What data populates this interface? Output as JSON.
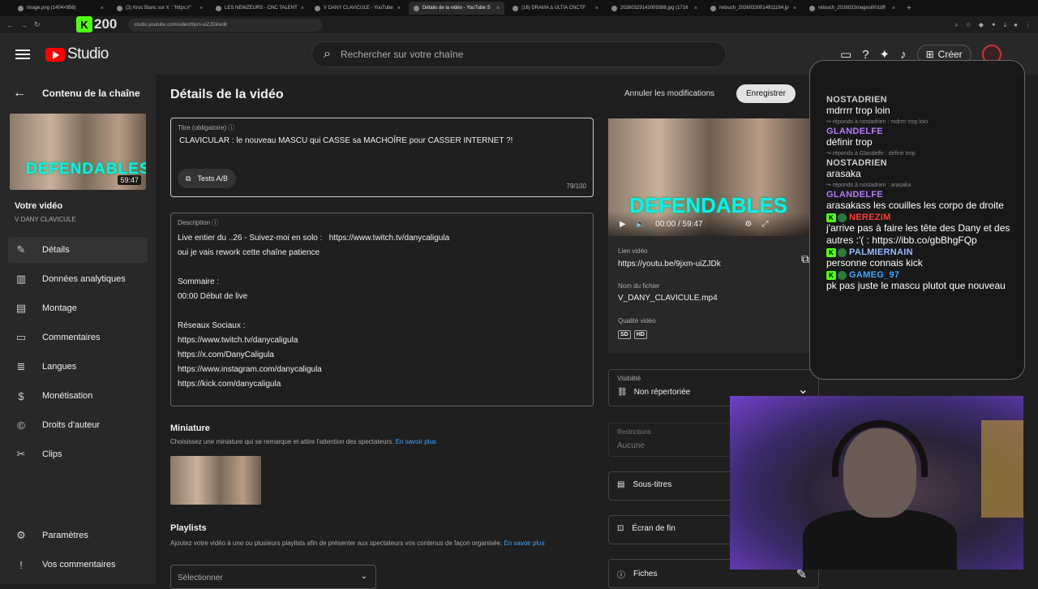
{
  "browser": {
    "tabs": [
      {
        "label": "image.png (1404×956)",
        "active": false
      },
      {
        "label": "(2) Kroc Blanc sur X : \"https://\"",
        "active": false
      },
      {
        "label": "LES NEWZEURS - CNC TALENT",
        "active": false
      },
      {
        "label": "V DANY CLAVICULE - YouTube",
        "active": false
      },
      {
        "label": "Détails de la vidéo - YouTube S",
        "active": true
      },
      {
        "label": "(16) DRAMA ∆ ULTIA CNCTF",
        "active": false
      },
      {
        "label": "20260329143009398.jpg (1716",
        "active": false
      },
      {
        "label": "retouch_20260330014911184.jp",
        "active": false
      },
      {
        "label": "retouch_2026033megesi001dff",
        "active": false
      }
    ],
    "url": "studio.youtube.com/video/9jxm-uiZJDk/edit",
    "kick_badge": "200"
  },
  "header": {
    "logo_text": "Studio",
    "search_placeholder": "Rechercher sur votre chaîne",
    "create_label": "Créer"
  },
  "sidebar": {
    "back_label": "Contenu de la chaîne",
    "duration": "59:47",
    "thumb_text": "DEFENDABLES",
    "your_video": "Votre vidéo",
    "channel": "V DANY CLAVICULE",
    "items": [
      {
        "label": "Détails",
        "icon": "pencil-icon",
        "glyph": "✎",
        "selected": true
      },
      {
        "label": "Données analytiques",
        "icon": "analytics-icon",
        "glyph": "▥",
        "selected": false
      },
      {
        "label": "Montage",
        "icon": "editor-icon",
        "glyph": "▤",
        "selected": false
      },
      {
        "label": "Commentaires",
        "icon": "comments-icon",
        "glyph": "▭",
        "selected": false
      },
      {
        "label": "Langues",
        "icon": "subtitles-icon",
        "glyph": "≣",
        "selected": false
      },
      {
        "label": "Monétisation",
        "icon": "dollar-icon",
        "glyph": "$",
        "selected": false
      },
      {
        "label": "Droits d'auteur",
        "icon": "copyright-icon",
        "glyph": "©",
        "selected": false
      },
      {
        "label": "Clips",
        "icon": "scissors-icon",
        "glyph": "✂",
        "selected": false
      }
    ],
    "bottom_items": [
      {
        "label": "Paramètres",
        "icon": "gear-icon",
        "glyph": "⚙"
      },
      {
        "label": "Vos commentaires",
        "icon": "feedback-icon",
        "glyph": "!"
      }
    ]
  },
  "main": {
    "page_title": "Détails de la vidéo",
    "undo_label": "Annuler les modifications",
    "save_label": "Enregistrer",
    "title_field": {
      "label": "Titre (obligatoire)",
      "value": "CLAVICULAR : le nouveau MASCU qui CASSE sa MACHOÎRE pour CASSER INTERNET ?!",
      "counter": "79/100",
      "ab_label": "Tests A/B"
    },
    "description": {
      "label": "Description",
      "value": "Live entier du ..26 - Suivez-moi en solo :   https://www.twitch.tv/danycaligula\noui je vais rework cette chaîne patience\n\nSommaire :\n00:00 Début de live\n\nRéseaux Sociaux :\nhttps://www.twitch.tv/danycaligula\nhttps://x.com/DanyCaligula\nhttps://www.instagram.com/danycaligula\nhttps://kick.com/danycaligula"
    },
    "thumbnail": {
      "title": "Miniature",
      "sub": "Choisissez une miniature qui se remarque et attire l'attention des spectateurs.",
      "link": "En savoir plus"
    },
    "playlists": {
      "title": "Playlists",
      "sub": "Ajoutez votre vidéo à une ou plusieurs playlists afin de présenter aux spectateurs vos contenus de façon organisée.",
      "link": "En savoir plus",
      "select": "Sélectionner"
    }
  },
  "right": {
    "preview_text": "DEFENDABLES",
    "time": "00:00 / 59:47",
    "video_link_label": "Lien vidéo",
    "video_link": "https://youtu.be/9jxm-uiZJDk",
    "filename_label": "Nom du fichier",
    "filename": "V_DANY_CLAVICULE.mp4",
    "quality_label": "Qualité vidéo",
    "quality": [
      "SD",
      "HD"
    ],
    "visibility_label": "Visibilité",
    "visibility": "Non répertoriée",
    "restrictions_label": "Restrictions",
    "restrictions": "Aucune",
    "subtitles": "Sous-titres",
    "end_screen": "Écran de fin",
    "cards": "Fiches"
  },
  "chat": {
    "messages": [
      {
        "user": "NOSTADRIEN",
        "color": "#cccccc",
        "badge": false,
        "reply": "",
        "text": "mdrrrr trop loin"
      },
      {
        "user": "GLANDELFE",
        "color": "#b57bff",
        "badge": false,
        "reply": "↪ réponds à nostadrien : mdrrrr trop loin",
        "text": "définir trop"
      },
      {
        "user": "NOSTADRIEN",
        "color": "#cccccc",
        "badge": false,
        "reply": "↪ réponds à Glandelfe : définir trop",
        "text": "arasaka"
      },
      {
        "user": "GLANDELFE",
        "color": "#b57bff",
        "badge": false,
        "reply": "↪ réponds à nostadrien : arasaka",
        "text": "arasakass les couilles les corpo de droite"
      },
      {
        "user": "NEREZIM",
        "color": "#ff3b3b",
        "badge": true,
        "reply": "",
        "text": "j'arrive pas à faire les tête des Dany et des autres :'( : https://ibb.co/gbBhgFQp"
      },
      {
        "user": "PALMIERNAIN",
        "color": "#9ab8ff",
        "badge": true,
        "reply": "",
        "text": "personne connais kick"
      },
      {
        "user": "GAMEG_97",
        "color": "#3ea6ff",
        "badge": true,
        "reply": "",
        "text": "pk pas juste le mascu plutot que nouveau"
      }
    ]
  }
}
